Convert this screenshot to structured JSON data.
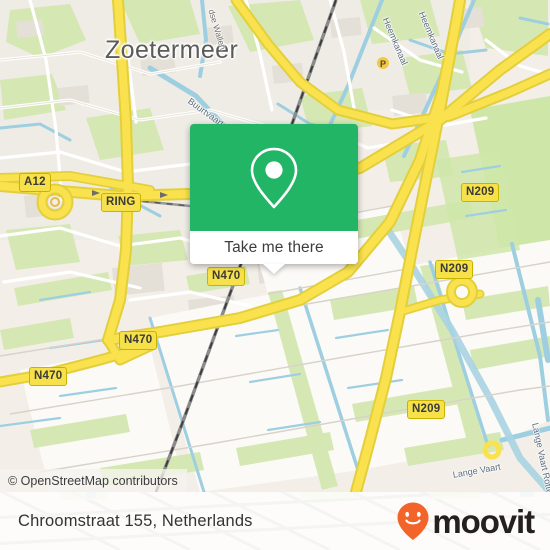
{
  "map": {
    "city_label": "Zoetermeer",
    "attribution": "© OpenStreetMap contributors",
    "water_labels": [
      {
        "text": "Buurtvaart"
      },
      {
        "text": "Heemkanaal"
      },
      {
        "text": "Heemkanaal"
      },
      {
        "text": "Lange Vaart Rotte"
      },
      {
        "text": "Lange Vaart"
      }
    ],
    "street_labels": [
      {
        "text": "dse Wallen"
      }
    ],
    "road_shields": [
      {
        "label": "A12"
      },
      {
        "label": "RING"
      },
      {
        "label": "N209"
      },
      {
        "label": "N209"
      },
      {
        "label": "N209"
      },
      {
        "label": "N470"
      },
      {
        "label": "N470"
      },
      {
        "label": "N470"
      }
    ],
    "colors": {
      "land": "#f3efe8",
      "water": "#aad3df",
      "green": "#cfe6a9",
      "major_road": "#f7e14a",
      "road_casing": "#c9b200",
      "building": "#e3dfd8",
      "rail": "#707070"
    }
  },
  "popup": {
    "icon": "map-pin-icon",
    "button_label": "Take me there",
    "accent_color": "#22b565"
  },
  "footer": {
    "address": "Chroomstraat 155, Netherlands",
    "brand_name": "moovit",
    "brand_icon": "moovit-pin-smiley-icon",
    "brand_color": "#f3642a"
  }
}
